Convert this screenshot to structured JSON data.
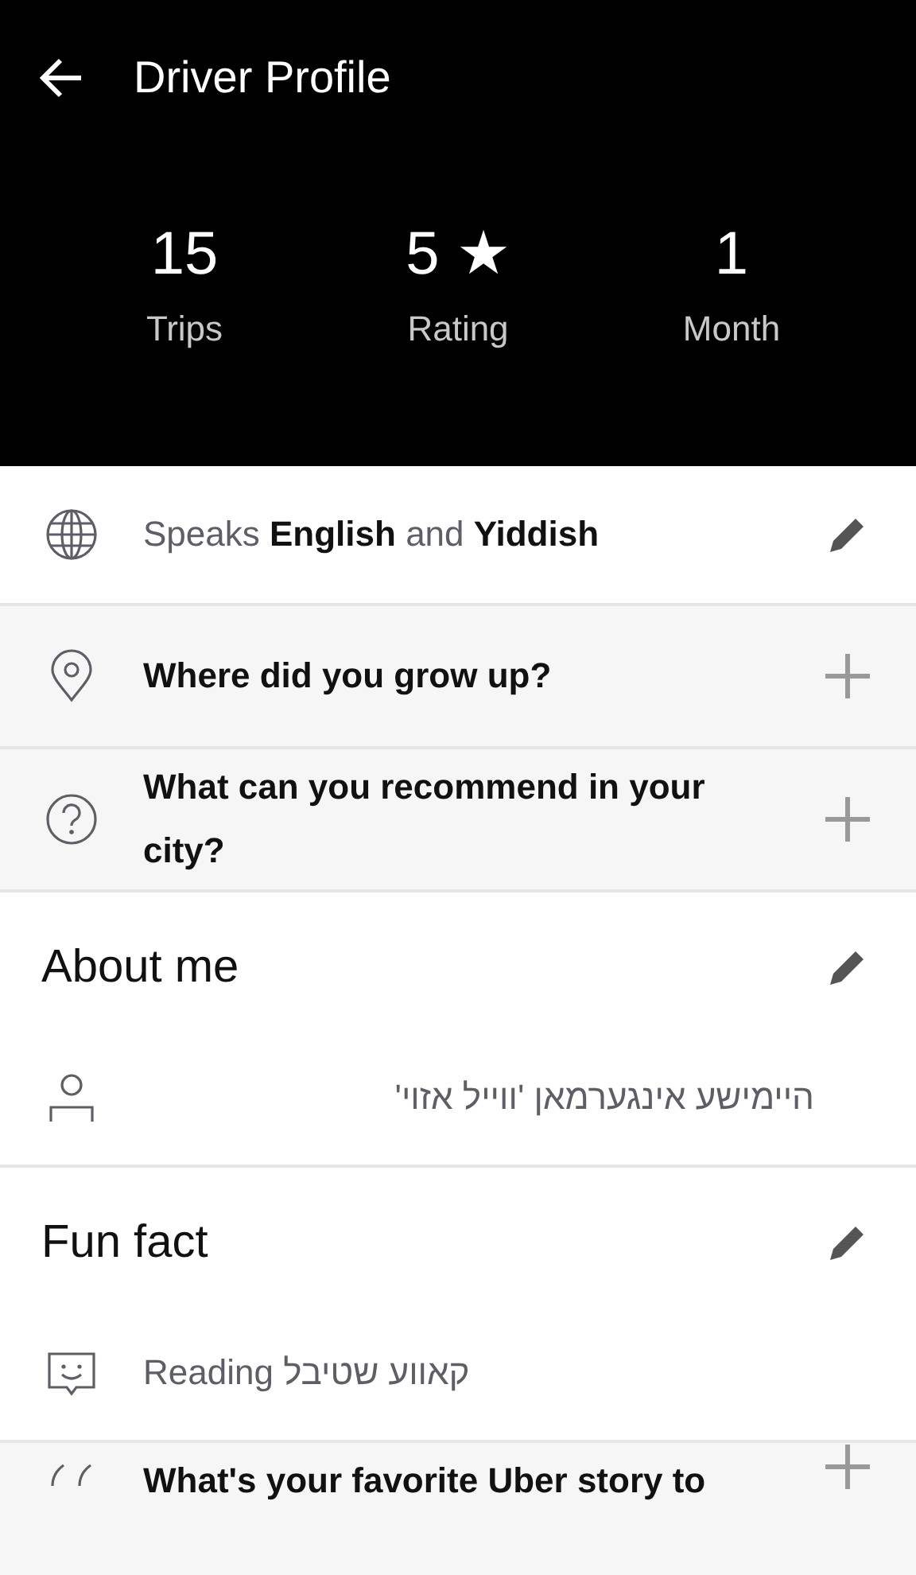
{
  "header": {
    "title": "Driver Profile",
    "stats": [
      {
        "value": "15",
        "label": "Trips"
      },
      {
        "value": "5",
        "suffix": "★",
        "label": "Rating"
      },
      {
        "value": "1",
        "label": "Month"
      }
    ]
  },
  "languages": {
    "text": "Speaks **English** and **Yiddish**"
  },
  "items": [
    {
      "kind": "prompt",
      "text": "Where did you grow up?"
    },
    {
      "kind": "prompt",
      "text": "What can you recommend in your city?"
    },
    {
      "kind": "section",
      "title": "About me",
      "text": "היימישע אינגערמאן 'ווייל אזוי'"
    },
    {
      "kind": "section",
      "title": "Fun fact",
      "text": "Reading קאווע שטיבל"
    },
    {
      "kind": "prompt",
      "text": "What's your favorite Uber story to"
    }
  ]
}
